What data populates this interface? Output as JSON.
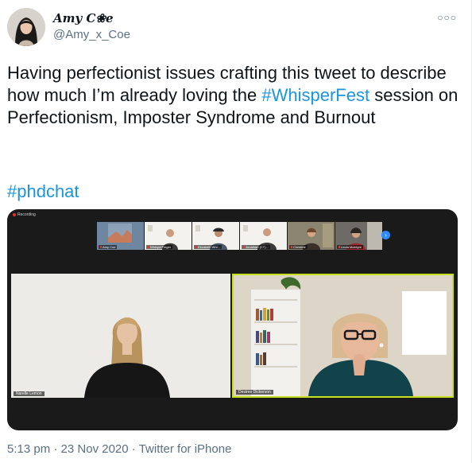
{
  "author": {
    "display_name": "Amy C❀e",
    "handle": "@Amy_x_Coe"
  },
  "more_icon": "more-horizontal-icon",
  "tweet": {
    "text_before_hashtag": "Having perfectionist issues crafting this tweet to describe how much I’m already loving the ",
    "hashtag_inline": "#WhisperFest",
    "text_after_hashtag": " session on Perfectionism, Imposter Syndrome and Burnout",
    "hashtag_line": "#phdchat"
  },
  "media": {
    "recording_label": "Recording",
    "thumbnails": [
      {
        "name": "Amy Coe"
      },
      {
        "name": "WhisperFinger"
      },
      {
        "name": "Elizabeth Whi..."
      },
      {
        "name": "Jonathan (CT)..."
      },
      {
        "name": "Christine"
      },
      {
        "name": "Linda Mcintyre"
      }
    ],
    "main_left_name": "Narelle Lemon",
    "main_right_name": "Desiree Dickerson"
  },
  "footer": {
    "time": "5:13 pm",
    "date": "23 Nov 2020",
    "source": "Twitter for iPhone",
    "separator": " · "
  },
  "colors": {
    "link": "#1b95e0",
    "secondary_text": "#5b7083",
    "active_speaker_border": "#c6e01f"
  }
}
